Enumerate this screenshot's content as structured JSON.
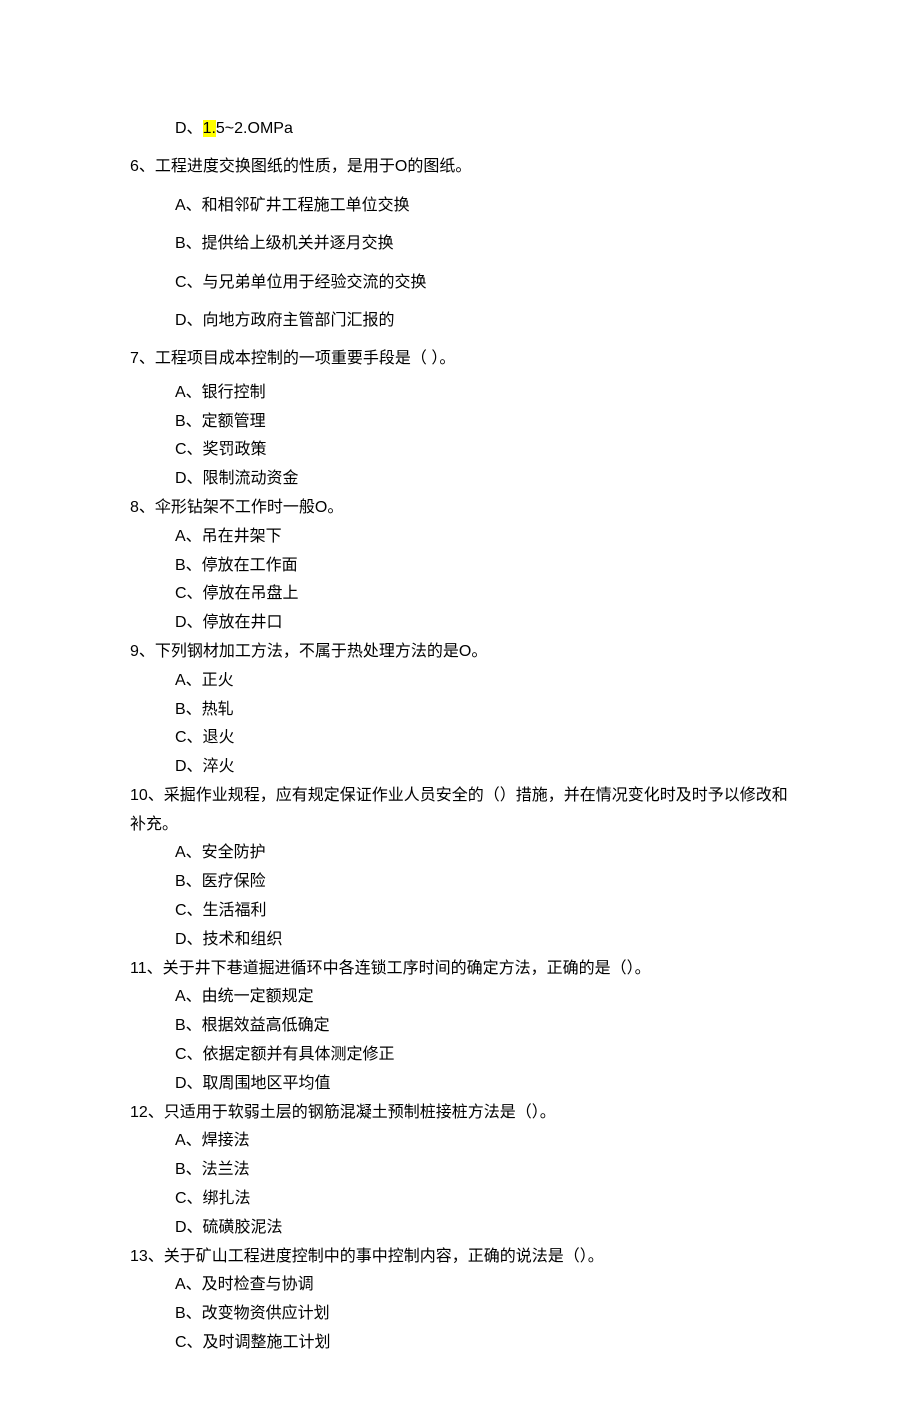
{
  "q5": {
    "optD_prefix": "D、",
    "optD_hl": "1.",
    "optD_rest": "5~2.OMPa"
  },
  "q6": {
    "stem": "6、工程进度交换图纸的性质，是用于O的图纸。",
    "A": "A、和相邻矿井工程施工单位交换",
    "B": "B、提供给上级机关并逐月交换",
    "C": "C、与兄弟单位用于经验交流的交换",
    "D": "D、向地方政府主管部门汇报的"
  },
  "q7": {
    "stem": "7、工程项目成本控制的一项重要手段是（ ）。",
    "A": "A、银行控制",
    "B": "B、定额管理",
    "C": "C、奖罚政策",
    "D": "D、限制流动资金"
  },
  "q8": {
    "stem": "8、伞形钻架不工作时一般O。",
    "A": "A、吊在井架下",
    "B": "B、停放在工作面",
    "C": "C、停放在吊盘上",
    "D": "D、停放在井口"
  },
  "q9": {
    "stem": "9、下列钢材加工方法，不属于热处理方法的是O。",
    "A": "A、正火",
    "B": "B、热轧",
    "C": "C、退火",
    "D": "D、淬火"
  },
  "q10": {
    "stem": "10、采掘作业规程，应有规定保证作业人员安全的（）措施，并在情况变化时及时予以修改和补充。",
    "A": "A、安全防护",
    "B": "B、医疗保险",
    "C": "C、生活福利",
    "D": "D、技术和组织"
  },
  "q11": {
    "stem": "11、关于井下巷道掘进循环中各连锁工序时间的确定方法，正确的是（）。",
    "A": "A、由统一定额规定",
    "B": "B、根据效益高低确定",
    "C": "C、依据定额并有具体测定修正",
    "D": "D、取周围地区平均值"
  },
  "q12": {
    "stem": "12、只适用于软弱土层的钢筋混凝土预制桩接桩方法是（）。",
    "A": "A、焊接法",
    "B": "B、法兰法",
    "C": "C、绑扎法",
    "D": "D、硫磺胶泥法"
  },
  "q13": {
    "stem": "13、关于矿山工程进度控制中的事中控制内容，正确的说法是（）。",
    "A": "A、及时检查与协调",
    "B": "B、改变物资供应计划",
    "C": "C、及时调整施工计划"
  }
}
